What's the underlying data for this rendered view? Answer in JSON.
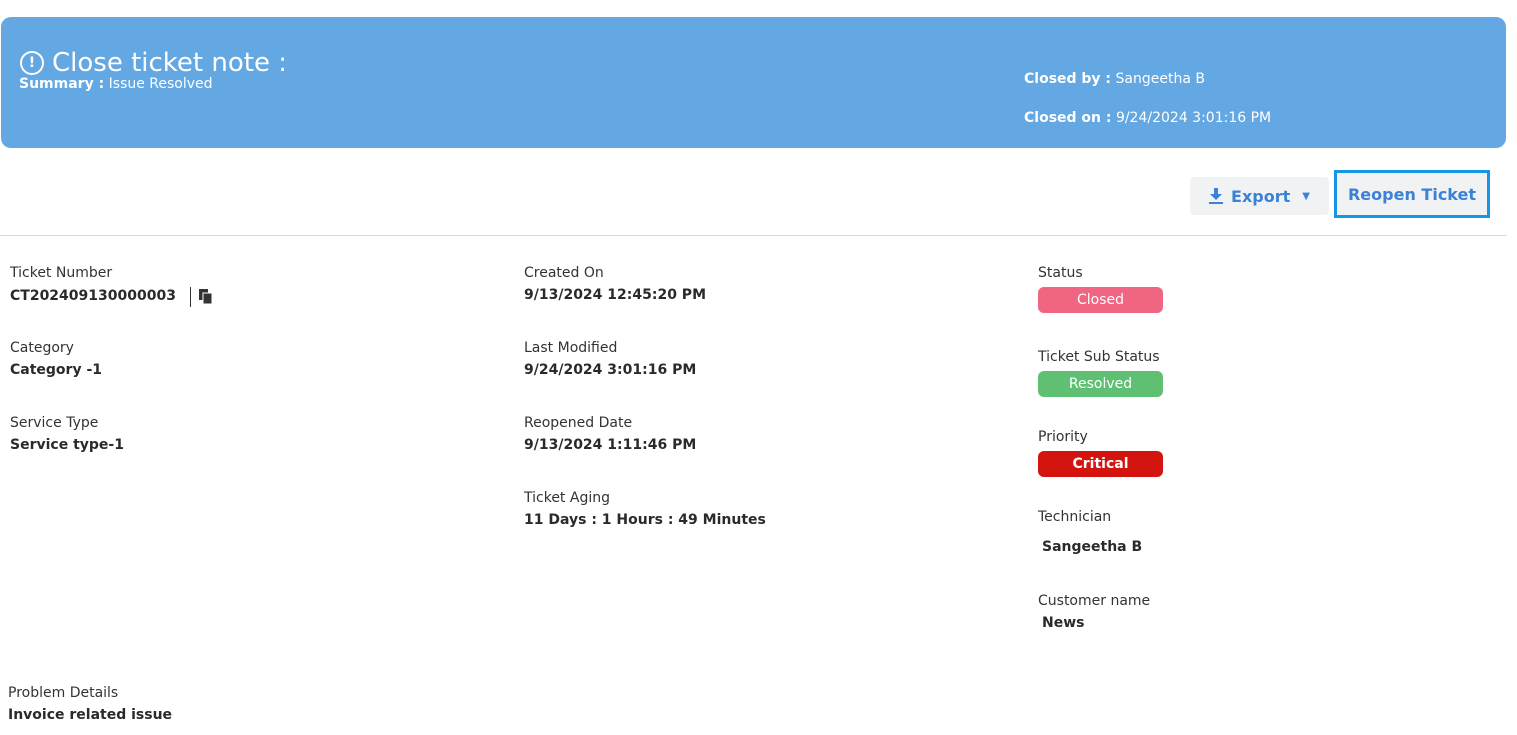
{
  "banner": {
    "title": "Close ticket note :",
    "summary_label": "Summary :",
    "summary_value": "Issue Resolved",
    "closed_by_label": "Closed by :",
    "closed_by_value": "Sangeetha B",
    "closed_on_label": "Closed on :",
    "closed_on_value": "9/24/2024 3:01:16 PM"
  },
  "toolbar": {
    "export_label": "Export",
    "reopen_label": "Reopen Ticket"
  },
  "details": {
    "ticket_number_label": "Ticket Number",
    "ticket_number_value": "CT202409130000003",
    "category_label": "Category",
    "category_value": "Category -1",
    "service_type_label": "Service Type",
    "service_type_value": "Service type-1",
    "created_on_label": "Created On",
    "created_on_value": "9/13/2024 12:45:20 PM",
    "last_modified_label": "Last Modified",
    "last_modified_value": "9/24/2024 3:01:16 PM",
    "reopened_date_label": "Reopened Date",
    "reopened_date_value": "9/13/2024 1:11:46 PM",
    "ticket_aging_label": "Ticket Aging",
    "ticket_aging_value": "11 Days : 1 Hours : 49 Minutes",
    "status_label": "Status",
    "status_value": "Closed",
    "sub_status_label": "Ticket Sub Status",
    "sub_status_value": "Resolved",
    "priority_label": "Priority",
    "priority_value": "Critical",
    "technician_label": "Technician",
    "technician_value": "Sangeetha B",
    "customer_label": "Customer name",
    "customer_value": "News",
    "problem_label": "Problem Details",
    "problem_value": "Invoice related issue"
  },
  "colors": {
    "banner": "#63a7e3",
    "accent": "#3b82d6",
    "status_closed": "#f06581",
    "status_resolved": "#5fbf72",
    "priority_critical": "#d4150f"
  },
  "icons": [
    "alert-circle-icon",
    "download-icon",
    "caret-down-icon",
    "copy-icon"
  ]
}
